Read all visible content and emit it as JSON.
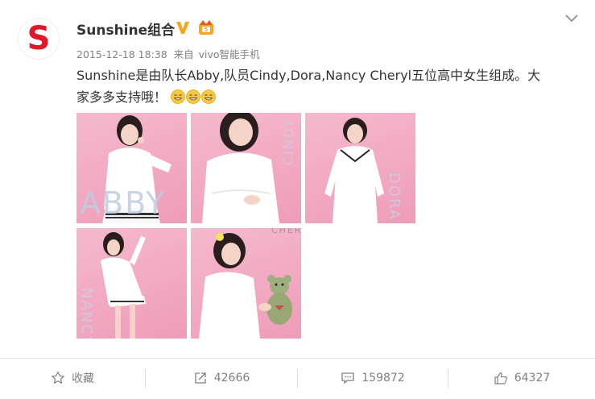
{
  "post": {
    "author": "Sunshine组合",
    "timestamp": "2015-12-18 18:38",
    "source_prefix": "来自",
    "source": "vivo智能手机",
    "text_line1": "Sunshine是由队长Abby,队员Cindy,Dora,Nancy Cheryl五位高中女生组成。大",
    "text_line2": "家多多支持哦！",
    "emoji_icons": [
      "grin-emoji",
      "grin-emoji",
      "grin-emoji"
    ]
  },
  "avatar": {
    "logo_letter": "S",
    "brand_color": "#e0182a"
  },
  "photos": [
    {
      "name": "photo-abby",
      "label": "ABBY"
    },
    {
      "name": "photo-cindy",
      "label": "CINDY"
    },
    {
      "name": "photo-dora",
      "label": "DORA"
    },
    {
      "name": "photo-nancy",
      "label": "NANCY"
    },
    {
      "name": "photo-cheryl",
      "label": "CHERYL"
    }
  ],
  "actions": {
    "favorite_label": "收藏",
    "repost_count": "42666",
    "comment_count": "159872",
    "like_count": "64327"
  },
  "colors": {
    "accent_orange": "#f6a623",
    "text_gray": "#808080",
    "photo_pink": "#f2a9c2"
  }
}
